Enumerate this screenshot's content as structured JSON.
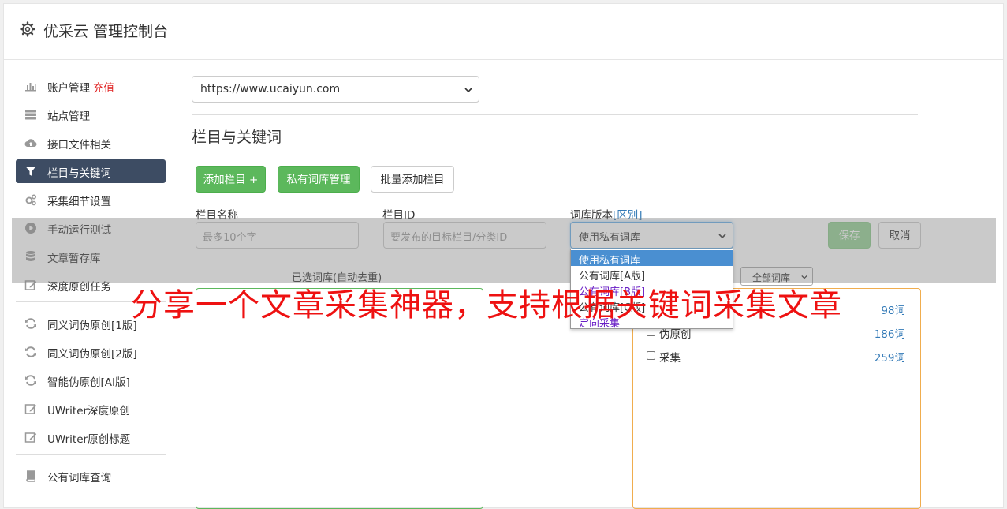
{
  "header": {
    "title": "优采云 管理控制台"
  },
  "sidebar": {
    "items": [
      {
        "label": "账户管理",
        "badge": "充值",
        "icon": "bar-chart-icon"
      },
      {
        "label": "站点管理",
        "icon": "server-icon"
      },
      {
        "label": "接口文件相关",
        "icon": "cloud-upload-icon"
      },
      {
        "label": "栏目与关键词",
        "icon": "filter-icon",
        "active": true
      },
      {
        "label": "采集细节设置",
        "icon": "cogs-icon"
      },
      {
        "label": "手动运行测试",
        "icon": "play-circle-icon"
      },
      {
        "label": "文章暂存库",
        "icon": "database-icon"
      },
      {
        "label": "深度原创任务",
        "icon": "edit-icon"
      }
    ],
    "items2": [
      {
        "label": "同义词伪原创[1版]",
        "icon": "refresh-icon"
      },
      {
        "label": "同义词伪原创[2版]",
        "icon": "refresh-icon"
      },
      {
        "label": "智能伪原创[AI版]",
        "icon": "refresh-icon"
      },
      {
        "label": "UWriter深度原创",
        "icon": "edit-icon"
      },
      {
        "label": "UWriter原创标题",
        "icon": "edit-icon"
      }
    ],
    "items3": [
      {
        "label": "公有词库查询",
        "icon": "book-icon"
      }
    ]
  },
  "main": {
    "site_select": "https://www.ucaiyun.com",
    "section_title": "栏目与关键词",
    "buttons": {
      "add_column": "添加栏目 +",
      "private_lib": "私有词库管理",
      "batch_add": "批量添加栏目"
    },
    "form": {
      "name_label": "栏目名称",
      "name_placeholder": "最多10个字",
      "id_label": "栏目ID",
      "id_placeholder": "要发布的目标栏目/分类ID",
      "version_label": "词库版本",
      "version_link": "[区别]",
      "version_value": "使用私有词库",
      "save": "保存",
      "cancel": "取消"
    },
    "version_options": [
      "使用私有词库",
      "公有词库[A版]",
      "公有词库[B版]",
      "公有词库[C版]",
      "定向采集"
    ],
    "selected_title": "已选词库(自动去重)",
    "filter_select": "全部词库",
    "libraries": [
      {
        "name": "",
        "count": "98词"
      },
      {
        "name": "伪原创",
        "count": "186词"
      },
      {
        "name": "采集",
        "count": "259词"
      }
    ]
  },
  "banner": {
    "text": "分享一个文章采集神器，支持根据关键词采集文章"
  },
  "colors": {
    "accent": "#3d4c63",
    "green": "#5cb85c",
    "red": "#ee1111",
    "link": "#337ab7"
  }
}
